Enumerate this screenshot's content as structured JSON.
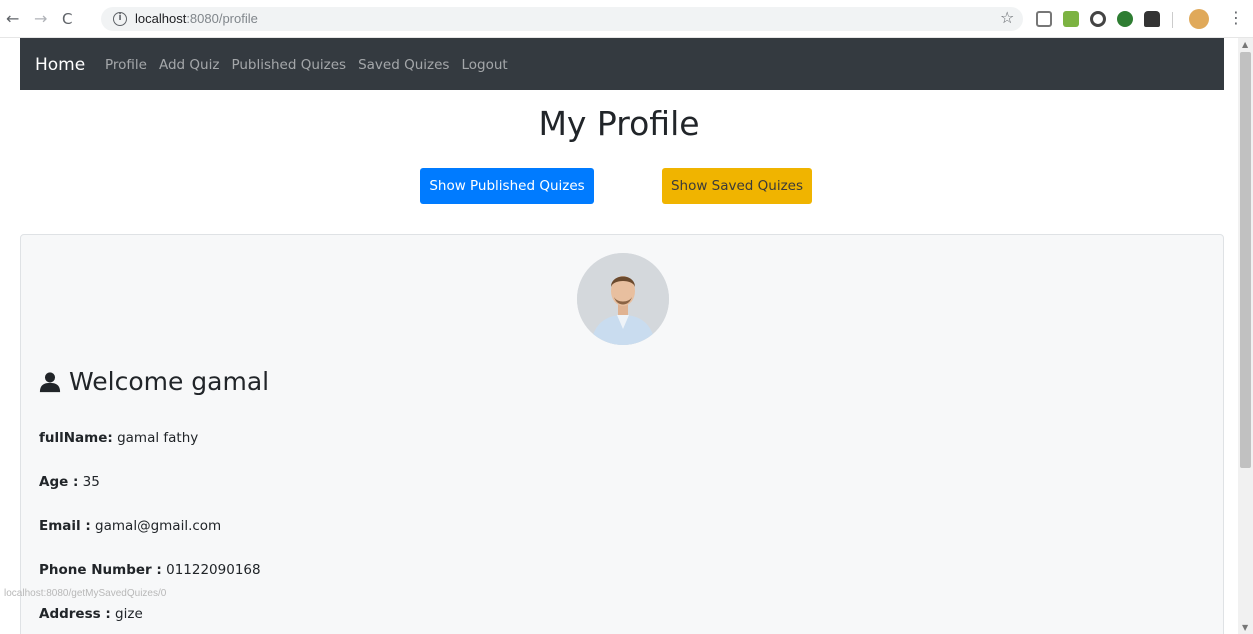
{
  "browser": {
    "url_host": "localhost",
    "url_rest": ":8080/profile",
    "status_url": "localhost:8080/getMySavedQuizes/0"
  },
  "navbar": {
    "brand": "Home",
    "links": [
      "Profile",
      "Add Quiz",
      "Published Quizes",
      "Saved Quizes",
      "Logout"
    ]
  },
  "page": {
    "title": "My Profile",
    "show_published_label": "Show Published Quizes",
    "show_saved_label": "Show Saved Quizes"
  },
  "profile": {
    "welcome": "Welcome gamal",
    "fields": [
      {
        "label": "fullName:",
        "value": " gamal fathy"
      },
      {
        "label": "Age :",
        "value": " 35"
      },
      {
        "label": "Email :",
        "value": " gamal@gmail.com"
      },
      {
        "label": "Phone Number :",
        "value": " 01122090168"
      },
      {
        "label": "Address :",
        "value": " gize"
      }
    ]
  },
  "colors": {
    "navbar_bg": "#343a40",
    "primary": "#007bff",
    "warning": "#f0b400"
  }
}
